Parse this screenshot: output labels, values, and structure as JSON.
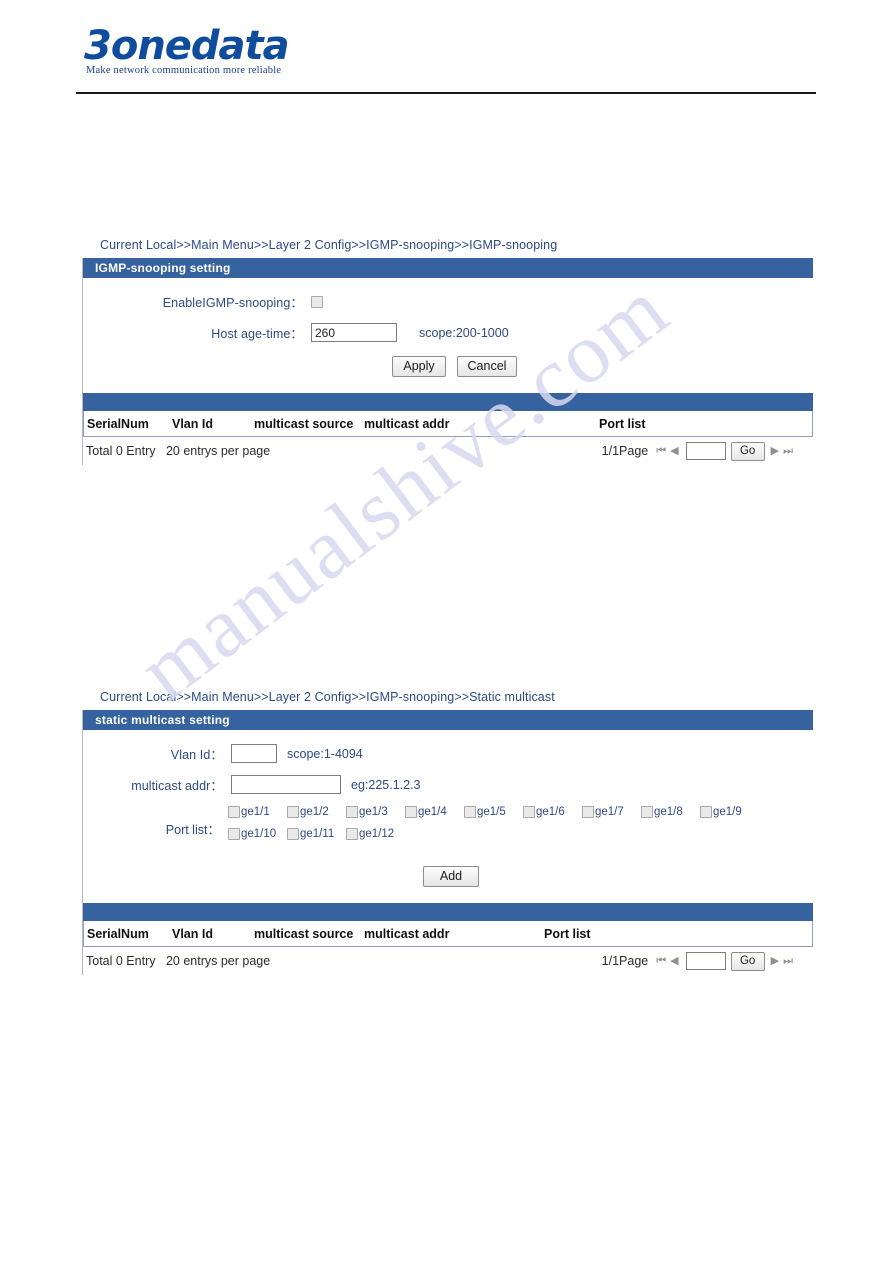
{
  "brand": {
    "logo_text": "3onedata",
    "tagline": "Make network communication more reliable"
  },
  "watermark": {
    "text": "manualshive.com"
  },
  "panels": [
    {
      "breadcrumb": "Current Local>>Main Menu>>Layer 2 Config>>IGMP-snooping>>IGMP-snooping",
      "title": "IGMP-snooping setting",
      "form": {
        "enable_label": "EnableIGMP-snooping：",
        "enable_checked": false,
        "age_label": "Host age-time：",
        "age_value": "260",
        "age_hint": "scope:200-1000",
        "apply_label": "Apply",
        "cancel_label": "Cancel"
      },
      "table": {
        "columns": [
          "SerialNum",
          "Vlan Id",
          "multicast source",
          "multicast addr",
          "Port list"
        ],
        "rows": [],
        "total_text": "Total 0 Entry",
        "per_page_text": "20 entrys per page",
        "page_indicator": "1/1Page",
        "page_input_value": "",
        "go_label": "Go",
        "first_icon": "first-page-icon",
        "prev_icon": "prev-page-icon",
        "next_icon": "next-page-icon",
        "last_icon": "last-page-icon"
      }
    },
    {
      "breadcrumb": "Current Local>>Main Menu>>Layer 2 Config>>IGMP-snooping>>Static multicast",
      "title": "static multicast setting",
      "form": {
        "vlan_label": "Vlan Id：",
        "vlan_value": "",
        "vlan_hint": "scope:1-4094",
        "maddr_label": "multicast addr：",
        "maddr_value": "",
        "maddr_hint": "eg:225.1.2.3",
        "portlist_label": "Port list：",
        "ports": [
          {
            "id": "ge1/1",
            "checked": false
          },
          {
            "id": "ge1/2",
            "checked": false
          },
          {
            "id": "ge1/3",
            "checked": false
          },
          {
            "id": "ge1/4",
            "checked": false
          },
          {
            "id": "ge1/5",
            "checked": false
          },
          {
            "id": "ge1/6",
            "checked": false
          },
          {
            "id": "ge1/7",
            "checked": false
          },
          {
            "id": "ge1/8",
            "checked": false
          },
          {
            "id": "ge1/9",
            "checked": false
          },
          {
            "id": "ge1/10",
            "checked": false
          },
          {
            "id": "ge1/11",
            "checked": false
          },
          {
            "id": "ge1/12",
            "checked": false
          }
        ],
        "add_label": "Add"
      },
      "table": {
        "columns": [
          "SerialNum",
          "Vlan Id",
          "multicast source",
          "multicast addr",
          "Port list"
        ],
        "rows": [],
        "total_text": "Total 0 Entry",
        "per_page_text": "20 entrys per page",
        "page_indicator": "1/1Page",
        "page_input_value": "",
        "go_label": "Go",
        "first_icon": "first-page-icon",
        "prev_icon": "prev-page-icon",
        "next_icon": "next-page-icon",
        "last_icon": "last-page-icon"
      }
    }
  ],
  "colors": {
    "bar_blue": "#36629f",
    "label_blue": "#2c4a87",
    "logo_blue": "#0f4c9e",
    "watermark": "#d9d9f0"
  }
}
